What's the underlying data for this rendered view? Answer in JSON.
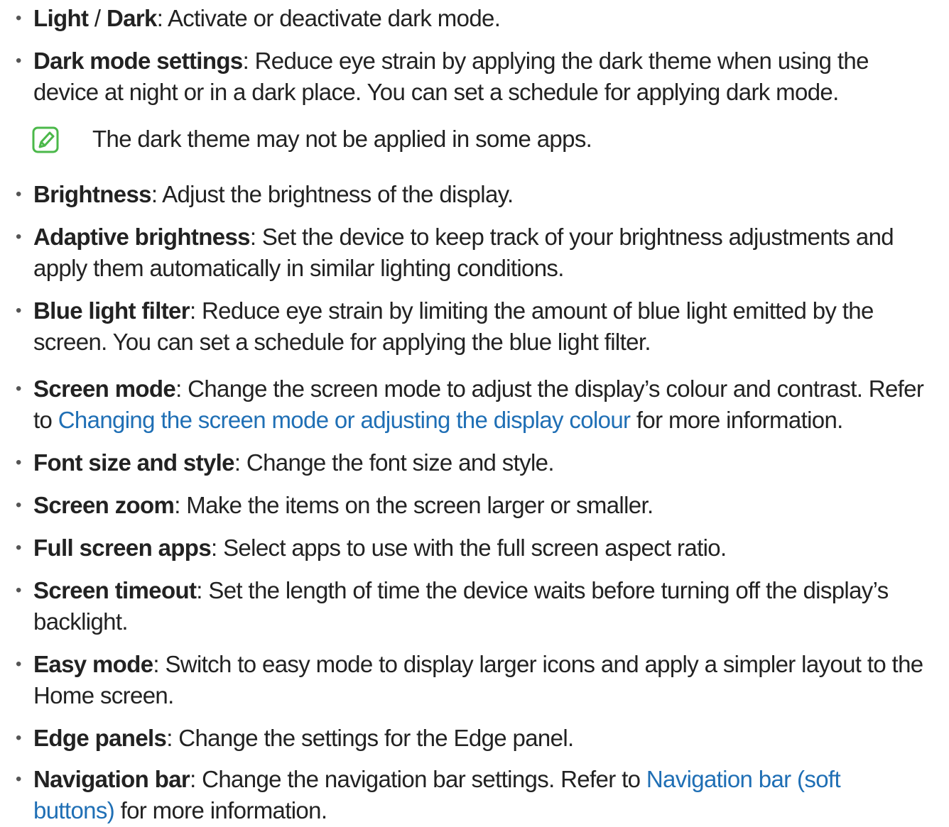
{
  "items": [
    {
      "title": "Light",
      "sep": " / ",
      "title2": "Dark",
      "desc": ": Activate or deactivate dark mode."
    },
    {
      "title": "Dark mode settings",
      "l1": ": Reduce eye strain by applying the dark theme when using the",
      "l2": "device at night or in a dark place. You can set a schedule for applying dark mode."
    },
    {
      "note": "The dark theme may not be applied in some apps."
    },
    {
      "title": "Brightness",
      "desc": ": Adjust the brightness of the display."
    },
    {
      "title": "Adaptive brightness",
      "l1": ": Set the device to keep track of your brightness adjustments and",
      "l2": "apply them automatically in similar lighting conditions."
    },
    {
      "title": "Blue light filter",
      "l1": ": Reduce eye strain by limiting the amount of blue light emitted by the",
      "l2": "screen. You can set a schedule for applying the blue light filter."
    },
    {
      "title": "Screen mode",
      "l1": ": Change the screen mode to adjust the display’s colour and contrast. Refer",
      "l2_pre": "to ",
      "l2_link": "Changing the screen mode or adjusting the display colour",
      "l2_post": " for more information."
    },
    {
      "title": "Font size and style",
      "desc": ": Change the font size and style."
    },
    {
      "title": "Screen zoom",
      "desc": ": Make the items on the screen larger or smaller."
    },
    {
      "title": "Full screen apps",
      "desc": ": Select apps to use with the full screen aspect ratio."
    },
    {
      "title": "Screen timeout",
      "l1": ": Set the length of time the device waits before turning off the display’s",
      "l2": "backlight."
    },
    {
      "title": "Easy mode",
      "l1": ": Switch to easy mode to display larger icons and apply a simpler layout to the",
      "l2": "Home screen."
    },
    {
      "title": "Edge panels",
      "desc": ": Change the settings for the Edge panel."
    },
    {
      "title": "Navigation bar",
      "l1_pre": ": Change the navigation bar settings. Refer to ",
      "l1_link": "Navigation bar (soft",
      "l2_link": "buttons)",
      "l2_post": " for more information."
    }
  ],
  "bullet": "•",
  "colors": {
    "text": "#222222",
    "link": "#1f6fb5",
    "note_icon": "#4bb84a"
  },
  "icons": {
    "note": "note-pencil-icon"
  }
}
